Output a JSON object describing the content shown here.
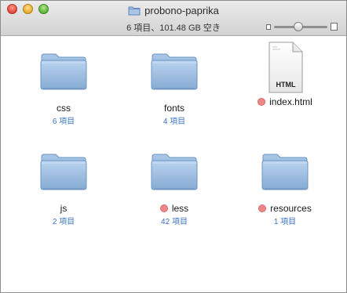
{
  "window": {
    "title": "probono-paprika",
    "status": "6 項目、101.48 GB 空き",
    "zoom_slider_value": 0.45
  },
  "items": [
    {
      "name": "css",
      "type": "folder",
      "count": "6 項目",
      "label_color": ""
    },
    {
      "name": "fonts",
      "type": "folder",
      "count": "4 項目",
      "label_color": ""
    },
    {
      "name": "index.html",
      "type": "html-file",
      "count": "",
      "label_color": "#f08585",
      "file_badge": "HTML"
    },
    {
      "name": "js",
      "type": "folder",
      "count": "2 項目",
      "label_color": ""
    },
    {
      "name": "less",
      "type": "folder",
      "count": "42 項目",
      "label_color": "#f08585"
    },
    {
      "name": "resources",
      "type": "folder",
      "count": "1 項目",
      "label_color": "#f08585"
    }
  ],
  "colors": {
    "folder": "#8fb3d9",
    "count_text": "#3b74c4",
    "label_red": "#f08585"
  }
}
